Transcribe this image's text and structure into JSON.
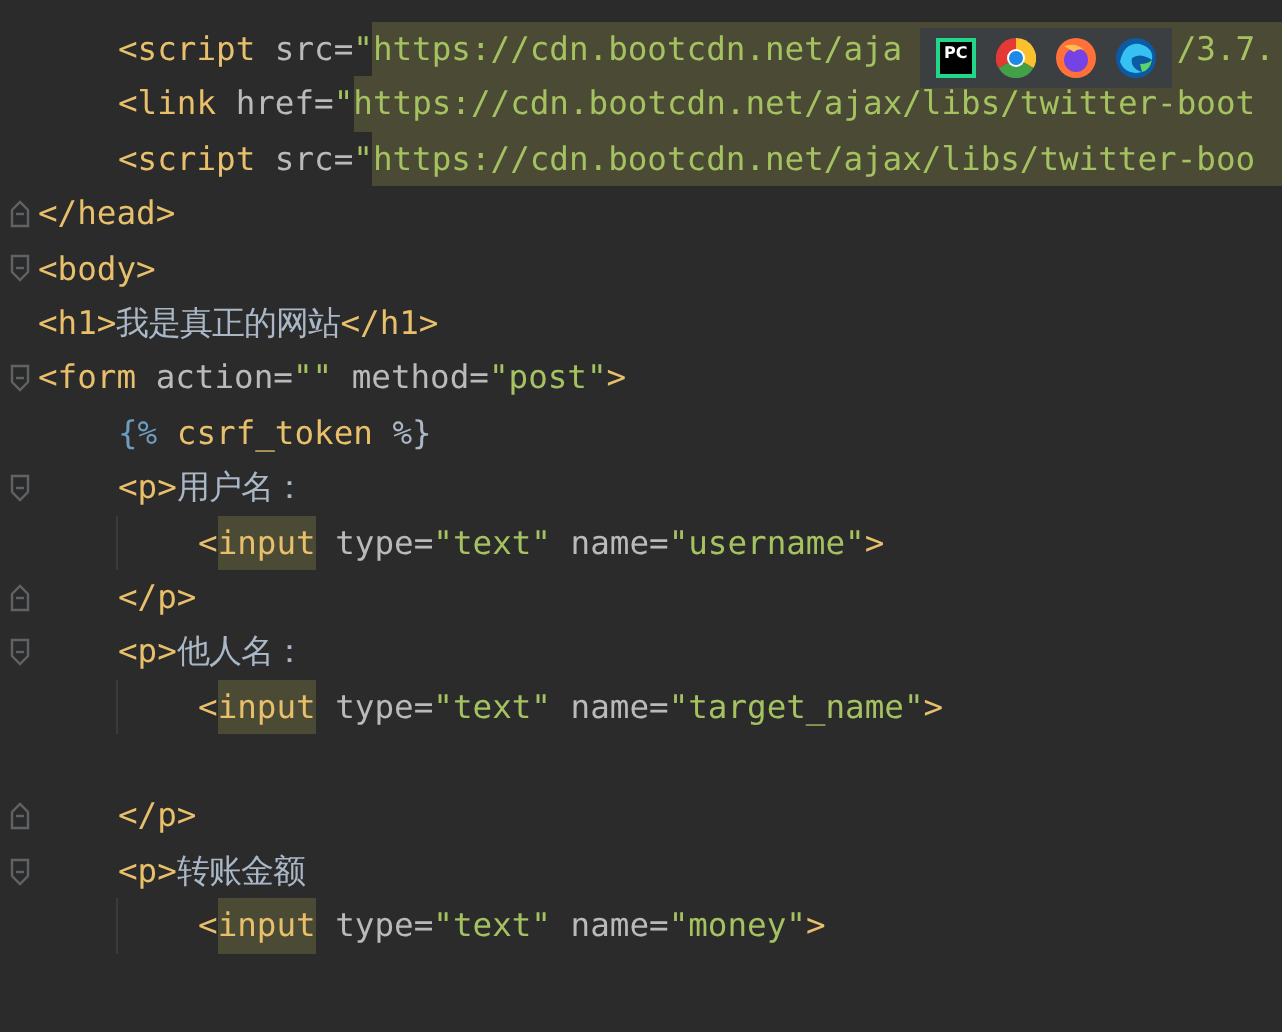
{
  "editor": {
    "lines": [
      {
        "children": [
          {
            "tokens": [
              {
                "kind": "tag",
                "text": "<script"
              },
              {
                "kind": "attr",
                "text": " src="
              },
              {
                "kind": "string",
                "text": "\""
              },
              {
                "kind": "string",
                "text": "https://cdn.bootcdn.net/aja",
                "marked": true
              },
              {
                "kind": "string",
                "text": "/3.7.",
                "marked": true,
                "after_cover": true
              }
            ]
          },
          {
            "tokens": [
              {
                "kind": "tag",
                "text": "<link"
              },
              {
                "kind": "attr",
                "text": " href="
              },
              {
                "kind": "string",
                "text": "\""
              },
              {
                "kind": "string",
                "text": "https://cdn.bootcdn.net/ajax/libs/twitter-boot",
                "marked": true
              }
            ]
          },
          {
            "tokens": [
              {
                "kind": "tag",
                "text": "<script"
              },
              {
                "kind": "attr",
                "text": " src="
              },
              {
                "kind": "string",
                "text": "\""
              },
              {
                "kind": "string",
                "text": "https://cdn.bootcdn.net/ajax/libs/twitter-boo",
                "marked": true
              }
            ]
          }
        ]
      },
      {
        "fold_end": true,
        "tokens": [
          {
            "kind": "tag",
            "text": "</head>"
          }
        ]
      },
      {
        "fold_start": true,
        "tokens": [
          {
            "kind": "tag",
            "text": "<body>"
          }
        ]
      },
      {
        "tokens": [
          {
            "kind": "tag",
            "text": "<h1>"
          },
          {
            "kind": "text",
            "text": "我是真正的网站"
          },
          {
            "kind": "tag",
            "text": "</h1>"
          }
        ]
      },
      {
        "fold_start": true,
        "tokens": [
          {
            "kind": "tag",
            "text": "<form"
          },
          {
            "kind": "attr",
            "text": " action="
          },
          {
            "kind": "string",
            "text": "\"\""
          },
          {
            "kind": "attr",
            "text": " method="
          },
          {
            "kind": "string",
            "text": "\"post\""
          },
          {
            "kind": "tag",
            "text": ">"
          }
        ],
        "children": [
          {
            "tokens": [
              {
                "kind": "brace",
                "text": "{%"
              },
              {
                "kind": "tag",
                "text": " csrf_token "
              },
              {
                "kind": "text",
                "text": "%}"
              }
            ]
          },
          {
            "fold_start": true,
            "tokens": [
              {
                "kind": "tag",
                "text": "<p>"
              },
              {
                "kind": "text",
                "text": "用户名："
              }
            ],
            "children": [
              {
                "tokens": [
                  {
                    "kind": "tag",
                    "text": "<"
                  },
                  {
                    "kind": "tag",
                    "text": "input",
                    "marked": true
                  },
                  {
                    "kind": "attr",
                    "text": " type="
                  },
                  {
                    "kind": "string",
                    "text": "\"text\""
                  },
                  {
                    "kind": "attr",
                    "text": " name="
                  },
                  {
                    "kind": "string",
                    "text": "\"username\""
                  },
                  {
                    "kind": "tag",
                    "text": ">"
                  }
                ]
              }
            ]
          },
          {
            "fold_end": true,
            "tokens": [
              {
                "kind": "tag",
                "text": "</p>"
              }
            ]
          },
          {
            "fold_start": true,
            "tokens": [
              {
                "kind": "tag",
                "text": "<p>"
              },
              {
                "kind": "text",
                "text": "他人名："
              }
            ],
            "children": [
              {
                "trailing_blank": true,
                "tokens": [
                  {
                    "kind": "tag",
                    "text": "<"
                  },
                  {
                    "kind": "tag",
                    "text": "input",
                    "marked": true
                  },
                  {
                    "kind": "attr",
                    "text": " type="
                  },
                  {
                    "kind": "string",
                    "text": "\"text\""
                  },
                  {
                    "kind": "attr",
                    "text": " name="
                  },
                  {
                    "kind": "string",
                    "text": "\"target_name\""
                  },
                  {
                    "kind": "tag",
                    "text": ">"
                  }
                ]
              }
            ]
          },
          {
            "fold_end": true,
            "tokens": [
              {
                "kind": "tag",
                "text": "</p>"
              }
            ]
          },
          {
            "fold_start": true,
            "tokens": [
              {
                "kind": "tag",
                "text": "<p>"
              },
              {
                "kind": "text",
                "text": "转账金额"
              }
            ],
            "children": [
              {
                "tokens": [
                  {
                    "kind": "tag",
                    "text": "<"
                  },
                  {
                    "kind": "tag",
                    "text": "input",
                    "marked": true
                  },
                  {
                    "kind": "attr",
                    "text": " type="
                  },
                  {
                    "kind": "string",
                    "text": "\"text\""
                  },
                  {
                    "kind": "attr",
                    "text": " name="
                  },
                  {
                    "kind": "string",
                    "text": "\"money\""
                  },
                  {
                    "kind": "tag",
                    "text": ">"
                  }
                ]
              }
            ]
          }
        ]
      }
    ]
  },
  "app_switcher": {
    "items": [
      {
        "kind": "square-logo",
        "label": "PC"
      },
      {
        "kind": "tricolor"
      },
      {
        "kind": "flame"
      },
      {
        "kind": "wave"
      }
    ]
  }
}
